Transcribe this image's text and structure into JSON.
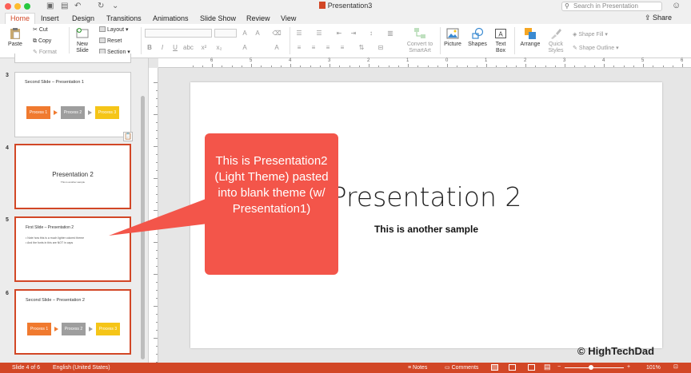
{
  "window": {
    "title": "Presentation3"
  },
  "search": {
    "placeholder": "Search in Presentation"
  },
  "tabs": [
    {
      "label": "Home"
    },
    {
      "label": "Insert"
    },
    {
      "label": "Design"
    },
    {
      "label": "Transitions"
    },
    {
      "label": "Animations"
    },
    {
      "label": "Slide Show"
    },
    {
      "label": "Review"
    },
    {
      "label": "View"
    }
  ],
  "share": {
    "label": "Share"
  },
  "ribbon": {
    "paste": "Paste",
    "cut": "Cut",
    "copy": "Copy",
    "format": "Format",
    "new_slide": "New Slide",
    "layout": "Layout",
    "reset": "Reset",
    "section": "Section",
    "convert_smartart": "Convert to SmartArt",
    "picture": "Picture",
    "shapes": "Shapes",
    "text_box": "Text Box",
    "arrange": "Arrange",
    "quick_styles": "Quick Styles",
    "shape_fill": "Shape Fill",
    "shape_outline": "Shape Outline",
    "bold": "B",
    "italic": "I",
    "underline": "U"
  },
  "ruler": {
    "numbers": [
      "6",
      "5",
      "4",
      "3",
      "2",
      "1",
      "0",
      "1",
      "2",
      "3",
      "4",
      "5",
      "6"
    ]
  },
  "thumbnails": [
    {
      "number": "3",
      "title": "Second Slide – Presentation 1",
      "processes": [
        "Process 1",
        "Process 2",
        "Process 3"
      ]
    },
    {
      "number": "4",
      "title": "Presentation 2",
      "subtitle": "This is another sample"
    },
    {
      "number": "5",
      "title": "First Slide – Presentation 2",
      "bullets": [
        "Note how this is a much lighter colored theme",
        "And the fonts in this are NOT in caps"
      ]
    },
    {
      "number": "6",
      "title": "Second Slide – Presentation 2",
      "processes": [
        "Process 1",
        "Process 2",
        "Process 3"
      ]
    }
  ],
  "slide": {
    "title": "Presentation 2",
    "subtitle": "This is another sample"
  },
  "callout": {
    "text": "This is Presentation2 (Light Theme) pasted into blank theme (w/ Presentation1)"
  },
  "status": {
    "slide_count": "Slide 4 of 6",
    "language": "English (United States)",
    "notes": "Notes",
    "comments": "Comments",
    "zoom": "101%"
  },
  "watermark": "© HighTechDad",
  "colors": {
    "accent": "#d24726",
    "callout": "#f3554a",
    "process1": "#f07a2f",
    "process2": "#9e9e9e",
    "process3": "#f5c518"
  }
}
